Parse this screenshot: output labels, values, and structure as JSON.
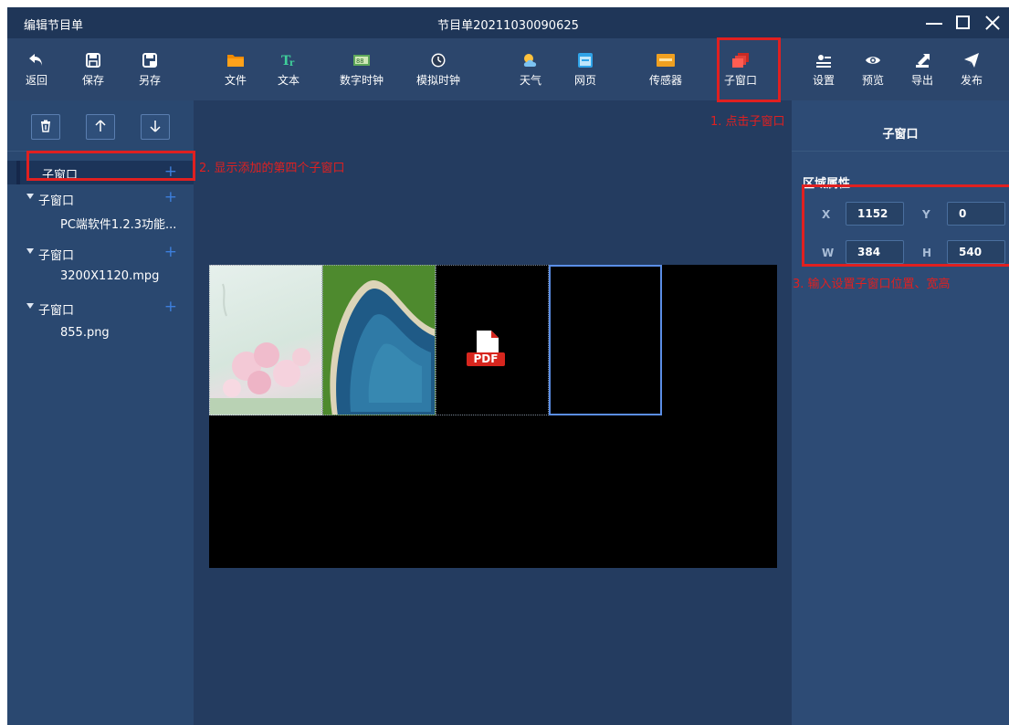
{
  "window": {
    "app_title": "编辑节目单",
    "doc_title": "节目单20211030090625"
  },
  "toolbar": {
    "back": {
      "label": "返回",
      "icon": "undo-icon"
    },
    "save": {
      "label": "保存",
      "icon": "save-icon"
    },
    "save_as": {
      "label": "另存",
      "icon": "save-as-icon"
    },
    "file": {
      "label": "文件",
      "icon": "folder-icon"
    },
    "text": {
      "label": "文本",
      "icon": "text-icon"
    },
    "digital_clock": {
      "label": "数字时钟",
      "icon": "digital-clock-icon"
    },
    "analog_clock": {
      "label": "模拟时钟",
      "icon": "analog-clock-icon"
    },
    "weather": {
      "label": "天气",
      "icon": "weather-icon"
    },
    "webpage": {
      "label": "网页",
      "icon": "webpage-icon"
    },
    "sensor": {
      "label": "传感器",
      "icon": "sensor-icon"
    },
    "subwindow": {
      "label": "子窗口",
      "icon": "subwindow-icon"
    },
    "settings": {
      "label": "设置",
      "icon": "settings-icon"
    },
    "preview": {
      "label": "预览",
      "icon": "eye-icon"
    },
    "export": {
      "label": "导出",
      "icon": "export-icon"
    },
    "publish": {
      "label": "发布",
      "icon": "send-icon"
    }
  },
  "tree": {
    "items": [
      {
        "label": "子窗口",
        "selected": true,
        "has_add": true
      },
      {
        "label": "子窗口",
        "expanded": true,
        "has_add": true
      },
      {
        "label": "PC端软件1.2.3功能...",
        "child": true
      },
      {
        "label": "子窗口",
        "expanded": true,
        "has_add": true
      },
      {
        "label": "3200X1120.mpg",
        "child": true
      },
      {
        "label": "子窗口",
        "expanded": true,
        "has_add": true
      },
      {
        "label": "855.png",
        "child": true
      }
    ],
    "add_glyph": "+"
  },
  "canvas": {
    "pdf_label": "PDF"
  },
  "properties": {
    "title": "子窗口",
    "section": "区域属性",
    "x_label": "X",
    "x_value": "1152",
    "y_label": "Y",
    "y_value": "0",
    "w_label": "W",
    "w_value": "384",
    "h_label": "H",
    "h_value": "540"
  },
  "annotations": {
    "step1": "1. 点击子窗口",
    "step2": "2. 显示添加的第四个子窗口",
    "step3": "3. 输入设置子窗口位置、宽高"
  },
  "colors": {
    "window_bg": "#253e62",
    "toolbar_bg": "#2c466c",
    "accent_blue": "#3d7fdc",
    "annotation_red": "#e02020"
  }
}
